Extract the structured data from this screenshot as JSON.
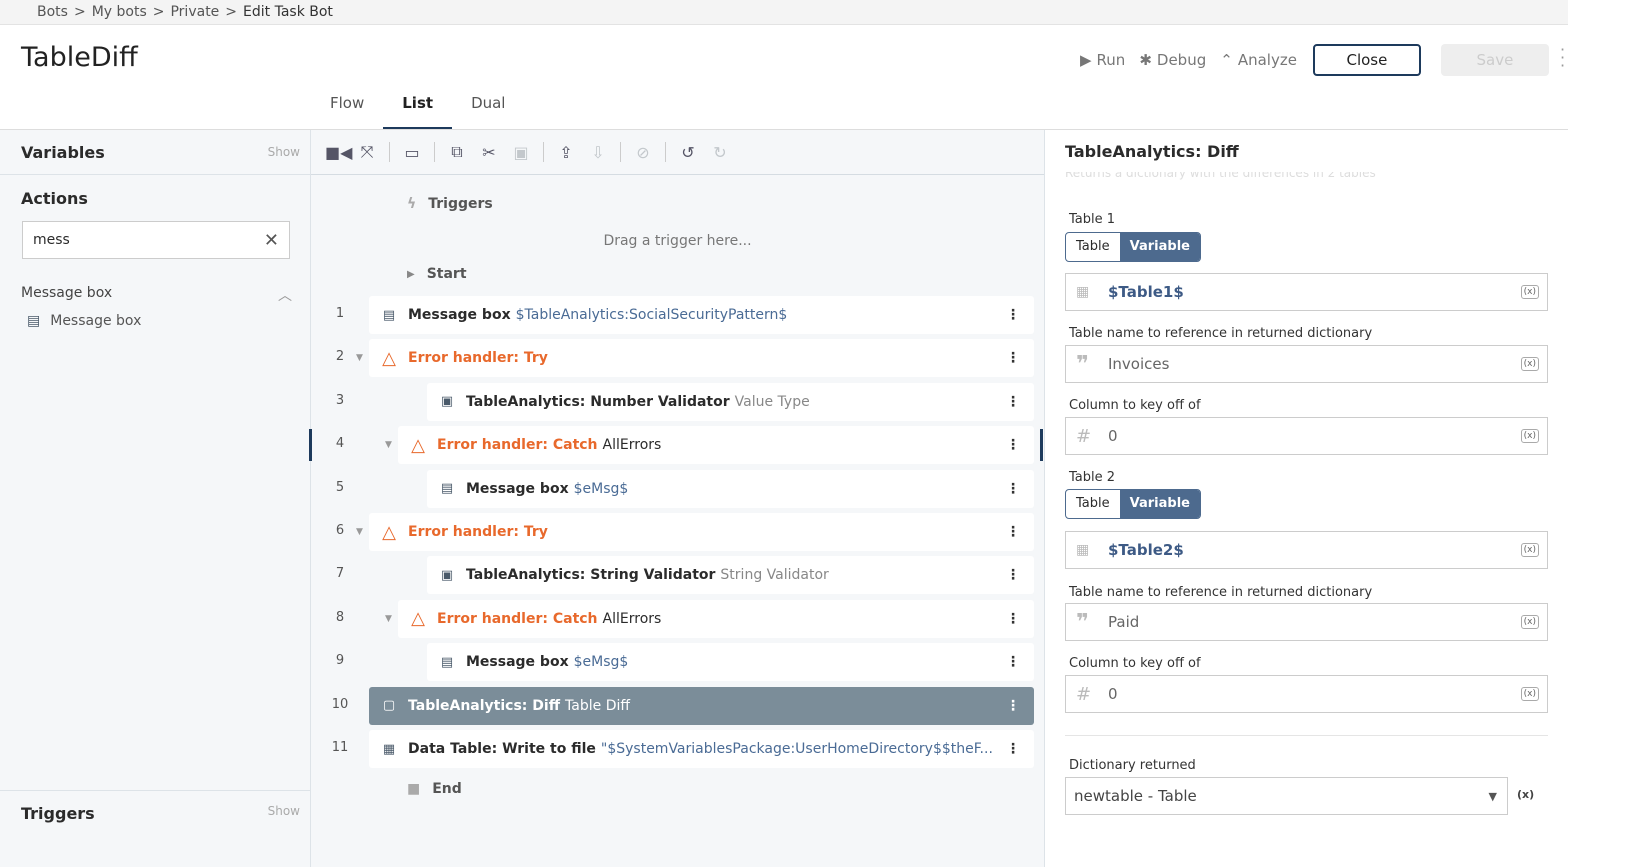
{
  "breadcrumb": [
    "Bots",
    ">",
    "My bots",
    ">",
    "Private",
    ">",
    "Edit Task Bot"
  ],
  "title": "TableDiff",
  "header_actions": {
    "run": "Run",
    "debug": "Debug",
    "analyze": "Analyze",
    "close": "Close",
    "save": "Save"
  },
  "tabs": [
    "Flow",
    "List",
    "Dual"
  ],
  "active_tab": "List",
  "left": {
    "variables": "Variables",
    "variables_show": "Show",
    "actions": "Actions",
    "search_value": "mess",
    "group": "Message box",
    "item": "Message box",
    "triggers": "Triggers",
    "triggers_show": "Show"
  },
  "flow": {
    "triggers": "Triggers",
    "drag": "Drag a trigger here...",
    "start": "Start",
    "end": "End",
    "rows": [
      {
        "n": "1",
        "indent": 0,
        "type": "msg",
        "kw": "Message box",
        "detail": "$TableAnalytics:SocialSecurityPattern$"
      },
      {
        "n": "2",
        "indent": 0,
        "type": "err",
        "kw": "Error handler: Try",
        "detail": "",
        "caret": true
      },
      {
        "n": "3",
        "indent": 2,
        "type": "pkg",
        "kw": "TableAnalytics: Number Validator",
        "detail": "Value Type",
        "gray": true
      },
      {
        "n": "4",
        "indent": 1,
        "type": "err",
        "kw": "Error handler: Catch",
        "detail": "AllErrors",
        "caret": true,
        "plain": true,
        "mark": true
      },
      {
        "n": "5",
        "indent": 2,
        "type": "msg",
        "kw": "Message box",
        "detail": "$eMsg$"
      },
      {
        "n": "6",
        "indent": 0,
        "type": "err",
        "kw": "Error handler: Try",
        "detail": "",
        "caret": true
      },
      {
        "n": "7",
        "indent": 2,
        "type": "pkg",
        "kw": "TableAnalytics: String Validator",
        "detail": "String Validator",
        "gray": true
      },
      {
        "n": "8",
        "indent": 1,
        "type": "err",
        "kw": "Error handler: Catch",
        "detail": "AllErrors",
        "caret": true,
        "plain": true
      },
      {
        "n": "9",
        "indent": 2,
        "type": "msg",
        "kw": "Message box",
        "detail": "$eMsg$"
      },
      {
        "n": "10",
        "indent": 0,
        "type": "sel",
        "kw": "TableAnalytics: Diff",
        "detail": "Table Diff"
      },
      {
        "n": "11",
        "indent": 0,
        "type": "tbl",
        "kw": "Data Table: Write to file",
        "detail": "\"$SystemVariablesPackage:UserHomeDirectory$$theF..."
      }
    ]
  },
  "panel": {
    "title": "TableAnalytics: Diff",
    "description": "Returns a dictionary with the differences in 2 tables",
    "table1_label": "Table 1",
    "seg_table": "Table",
    "seg_variable": "Variable",
    "table1_value": "$Table1$",
    "name1_label": "Table name to reference in returned dictionary",
    "name1_value": "Invoices",
    "key1_label": "Column to key off of",
    "key1_value": "0",
    "table2_label": "Table 2",
    "table2_value": "$Table2$",
    "name2_label": "Table name to reference in returned dictionary",
    "name2_value": "Paid",
    "key2_label": "Column to key off of",
    "key2_value": "0",
    "dict_label": "Dictionary returned",
    "dict_value": "newtable - Table",
    "var_icon": "(x)"
  },
  "colors": {
    "accent": "#1d3a5c",
    "error": "#e8692c",
    "selected_row": "#7b8d99",
    "variable": "#4d6a8e"
  }
}
